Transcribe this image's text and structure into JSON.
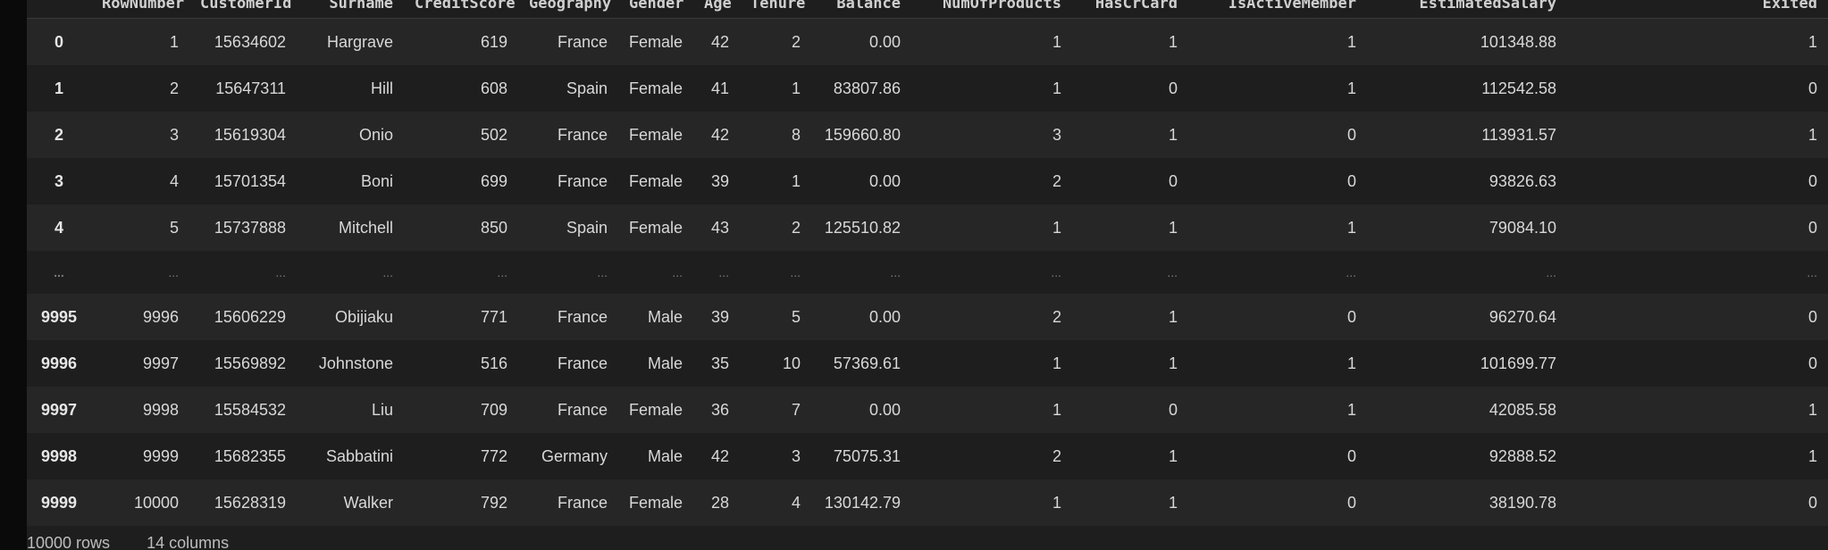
{
  "table": {
    "columns": [
      "",
      "RowNumber",
      "CustomerId",
      "Surname",
      "CreditScore",
      "Geography",
      "Gender",
      "Age",
      "Tenure",
      "Balance",
      "NumOfProducts",
      "HasCrCard",
      "IsActiveMember",
      "EstimatedSalary",
      "Exited"
    ],
    "rows": [
      [
        "0",
        "1",
        "15634602",
        "Hargrave",
        "619",
        "France",
        "Female",
        "42",
        "2",
        "0.00",
        "1",
        "1",
        "1",
        "101348.88",
        "1"
      ],
      [
        "1",
        "2",
        "15647311",
        "Hill",
        "608",
        "Spain",
        "Female",
        "41",
        "1",
        "83807.86",
        "1",
        "0",
        "1",
        "112542.58",
        "0"
      ],
      [
        "2",
        "3",
        "15619304",
        "Onio",
        "502",
        "France",
        "Female",
        "42",
        "8",
        "159660.80",
        "3",
        "1",
        "0",
        "113931.57",
        "1"
      ],
      [
        "3",
        "4",
        "15701354",
        "Boni",
        "699",
        "France",
        "Female",
        "39",
        "1",
        "0.00",
        "2",
        "0",
        "0",
        "93826.63",
        "0"
      ],
      [
        "4",
        "5",
        "15737888",
        "Mitchell",
        "850",
        "Spain",
        "Female",
        "43",
        "2",
        "125510.82",
        "1",
        "1",
        "1",
        "79084.10",
        "0"
      ],
      [
        "...",
        "...",
        "...",
        "...",
        "...",
        "...",
        "...",
        "...",
        "...",
        "...",
        "...",
        "...",
        "...",
        "...",
        "..."
      ],
      [
        "9995",
        "9996",
        "15606229",
        "Obijiaku",
        "771",
        "France",
        "Male",
        "39",
        "5",
        "0.00",
        "2",
        "1",
        "0",
        "96270.64",
        "0"
      ],
      [
        "9996",
        "9997",
        "15569892",
        "Johnstone",
        "516",
        "France",
        "Male",
        "35",
        "10",
        "57369.61",
        "1",
        "1",
        "1",
        "101699.77",
        "0"
      ],
      [
        "9997",
        "9998",
        "15584532",
        "Liu",
        "709",
        "France",
        "Female",
        "36",
        "7",
        "0.00",
        "1",
        "0",
        "1",
        "42085.58",
        "1"
      ],
      [
        "9998",
        "9999",
        "15682355",
        "Sabbatini",
        "772",
        "Germany",
        "Male",
        "42",
        "3",
        "75075.31",
        "2",
        "1",
        "0",
        "92888.52",
        "1"
      ],
      [
        "9999",
        "10000",
        "15628319",
        "Walker",
        "792",
        "France",
        "Female",
        "28",
        "4",
        "130142.79",
        "1",
        "1",
        "0",
        "38190.78",
        "0"
      ]
    ]
  },
  "footer": {
    "rows_text": "10000 rows",
    "cols_text": "14 columns"
  }
}
